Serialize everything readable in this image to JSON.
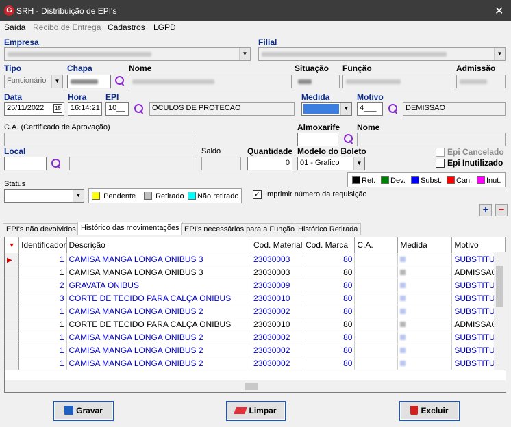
{
  "window": {
    "title": "SRH - Distribuição de EPI's",
    "close": "✕"
  },
  "menu": [
    "Saída",
    "Recibo de Entrega",
    "Cadastros",
    "LGPD"
  ],
  "form": {
    "empresa_label": "Empresa",
    "filial_label": "Filial",
    "tipo_label": "Tipo",
    "tipo_value": "Funcionário",
    "chapa_label": "Chapa",
    "nome_label": "Nome",
    "situacao_label": "Situação",
    "funcao_label": "Função",
    "admissao_label": "Admissão",
    "data_label": "Data",
    "data_value": "25/11/2022",
    "hora_label": "Hora",
    "hora_value": "16:14:21",
    "epi_label": "EPI",
    "epi_code": "10__",
    "epi_desc": "OCULOS DE PROTECAO",
    "medida_label": "Medida",
    "motivo_label": "Motivo",
    "motivo_code": "4___",
    "motivo_desc": "DEMISSAO",
    "ca_label": "C.A. (Certificado de Aprovação)",
    "almoxarife_label": "Almoxarife",
    "nome2_label": "Nome",
    "local_label": "Local",
    "saldo_label": "Saldo",
    "quantidade_label": "Quantidade",
    "quantidade_value": "0",
    "modelo_label": "Modelo do Boleto",
    "modelo_value": "01 - Grafico",
    "epi_cancelado": "Epi Cancelado",
    "epi_inutilizado": "Epi Inutilizado",
    "status_label": "Status",
    "imprimir": "Imprimir número da requisição",
    "imprimir_checked": "✓"
  },
  "status_legend": [
    {
      "label": "Pendente",
      "color": "#ffff00"
    },
    {
      "label": "Retirado",
      "color": "#c0c0c0"
    },
    {
      "label": "Não retirado",
      "color": "#00ffff"
    }
  ],
  "type_legend": [
    {
      "label": "Ret.",
      "color": "#000000"
    },
    {
      "label": "Dev.",
      "color": "#008000"
    },
    {
      "label": "Subst.",
      "color": "#0000ff"
    },
    {
      "label": "Can.",
      "color": "#ff0000"
    },
    {
      "label": "Inut.",
      "color": "#ff00ff"
    }
  ],
  "tabs": [
    "EPI's não devolvidos",
    "Histórico das movimentações",
    "EPI's necessários para a Função",
    "Histórico Retirada"
  ],
  "grid": {
    "columns": [
      "Identificador",
      "Descrição",
      "Cod. Material",
      "Cod. Marca",
      "C.A.",
      "Medida",
      "Motivo"
    ],
    "rows": [
      {
        "id": "1",
        "desc": "CAMISA MANGA LONGA ONIBUS 3",
        "mat": "23030003",
        "marca": "80",
        "motivo": "SUBSTITUI",
        "type": "subst",
        "current": true
      },
      {
        "id": "1",
        "desc": "CAMISA MANGA LONGA ONIBUS 3",
        "mat": "23030003",
        "marca": "80",
        "motivo": "ADMISSAO",
        "type": "ret"
      },
      {
        "id": "2",
        "desc": "GRAVATA ONIBUS",
        "mat": "23030009",
        "marca": "80",
        "motivo": "SUBSTITUI",
        "type": "subst"
      },
      {
        "id": "3",
        "desc": "CORTE DE TECIDO PARA CALÇA ONIBUS",
        "mat": "23030010",
        "marca": "80",
        "motivo": "SUBSTITUI",
        "type": "subst"
      },
      {
        "id": "1",
        "desc": "CAMISA MANGA LONGA ONIBUS 2",
        "mat": "23030002",
        "marca": "80",
        "motivo": "SUBSTITUI",
        "type": "subst"
      },
      {
        "id": "1",
        "desc": "CORTE DE TECIDO PARA CALÇA ONIBUS",
        "mat": "23030010",
        "marca": "80",
        "motivo": "ADMISSAO",
        "type": "ret"
      },
      {
        "id": "1",
        "desc": "CAMISA MANGA LONGA ONIBUS 2",
        "mat": "23030002",
        "marca": "80",
        "motivo": "SUBSTITUI",
        "type": "subst"
      },
      {
        "id": "1",
        "desc": "CAMISA MANGA LONGA ONIBUS 2",
        "mat": "23030002",
        "marca": "80",
        "motivo": "SUBSTITUI",
        "type": "subst"
      },
      {
        "id": "1",
        "desc": "CAMISA MANGA LONGA ONIBUS 2",
        "mat": "23030002",
        "marca": "80",
        "motivo": "SUBSTITUI",
        "type": "subst"
      }
    ]
  },
  "buttons": {
    "gravar": "Gravar",
    "limpar": "Limpar",
    "excluir": "Excluir",
    "add": "+",
    "remove": "−"
  }
}
